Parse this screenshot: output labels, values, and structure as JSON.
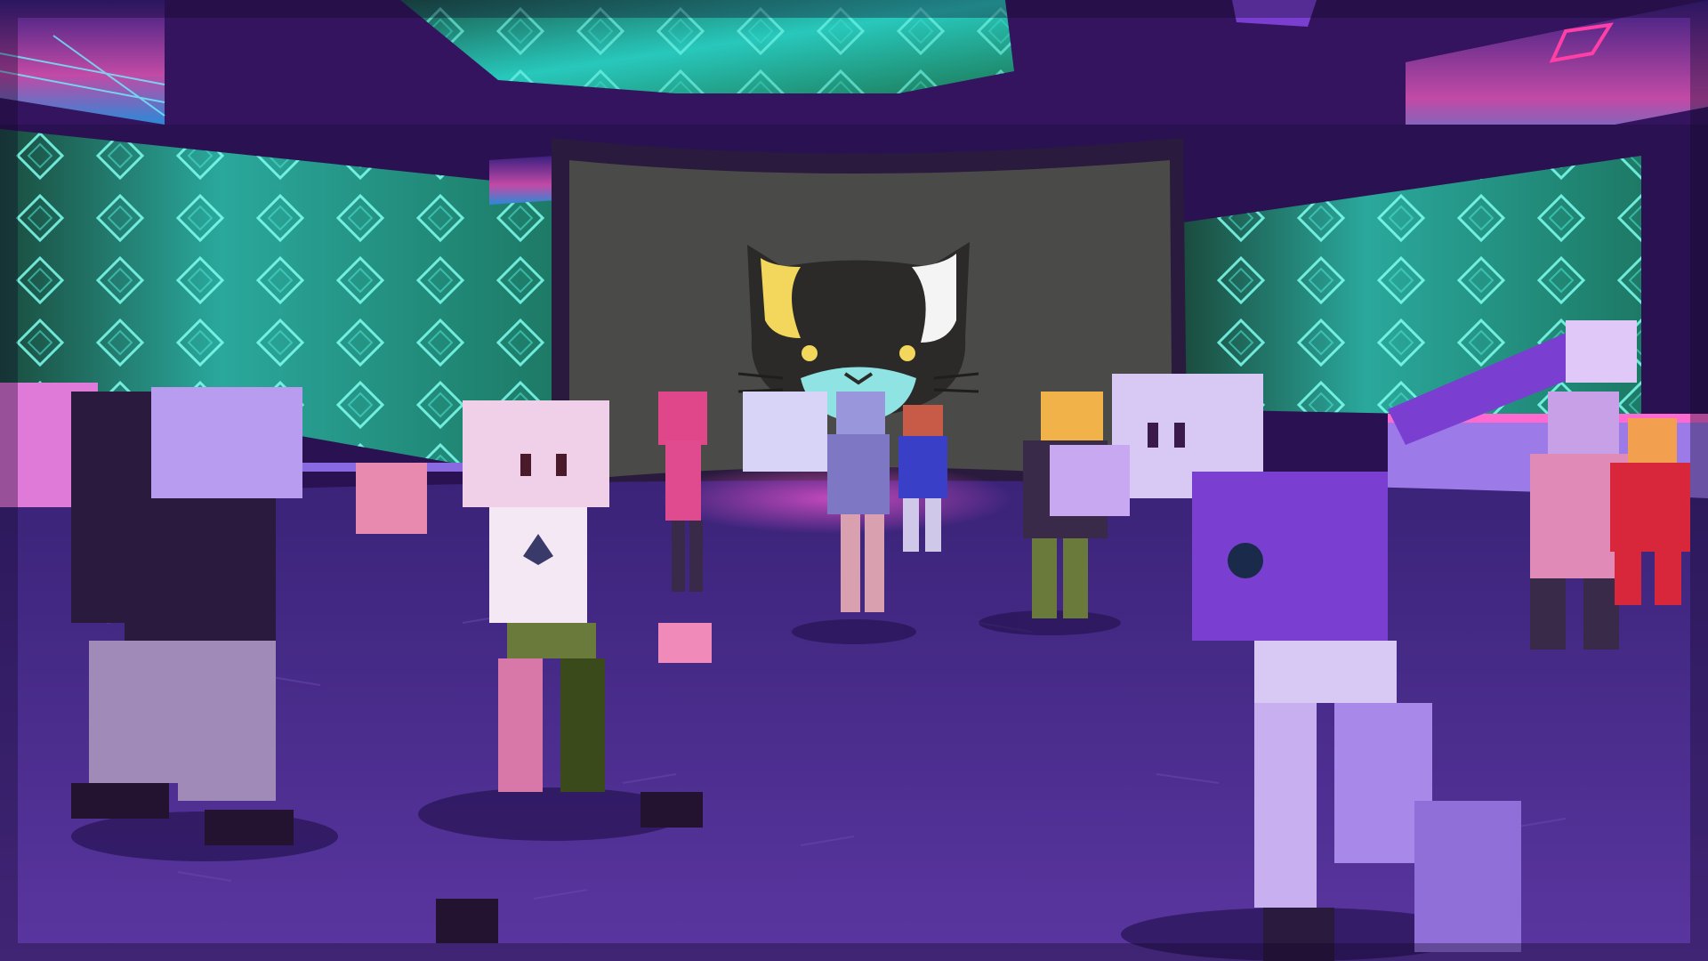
{
  "scene": {
    "type": "virtual-dance-club",
    "ui_text": [],
    "palette": {
      "sky": "#1e0a3c",
      "ceiling": "#3a1466",
      "floor": "#4a2c8c",
      "floor_dark": "#2f1a66",
      "screen_teal": "#2fd6c8",
      "screen_green": "#1c6a4a",
      "cat_screen": "#4a4a48",
      "cat_yellow": "#f2d75c",
      "cat_white": "#f4f4f4",
      "cat_mouth": "#8fe3e3",
      "avatar_lavender": "#b89cf0",
      "avatar_purple": "#7a3fd0",
      "avatar_pink": "#e07ad8",
      "avatar_dark": "#2a1a3e",
      "neon_pink": "#ff3fa6"
    },
    "screens": [
      {
        "name": "left-teal-screen",
        "pattern": "diamonds"
      },
      {
        "name": "right-teal-screen",
        "pattern": "diamonds"
      },
      {
        "name": "ceiling-teal-screen",
        "pattern": "diamonds"
      },
      {
        "name": "cat-logo-screen",
        "pattern": "cat-face"
      }
    ],
    "icons": [
      "cat-face-icon",
      "ethereum-icon",
      "solana-icon",
      "diamond-icon"
    ]
  }
}
